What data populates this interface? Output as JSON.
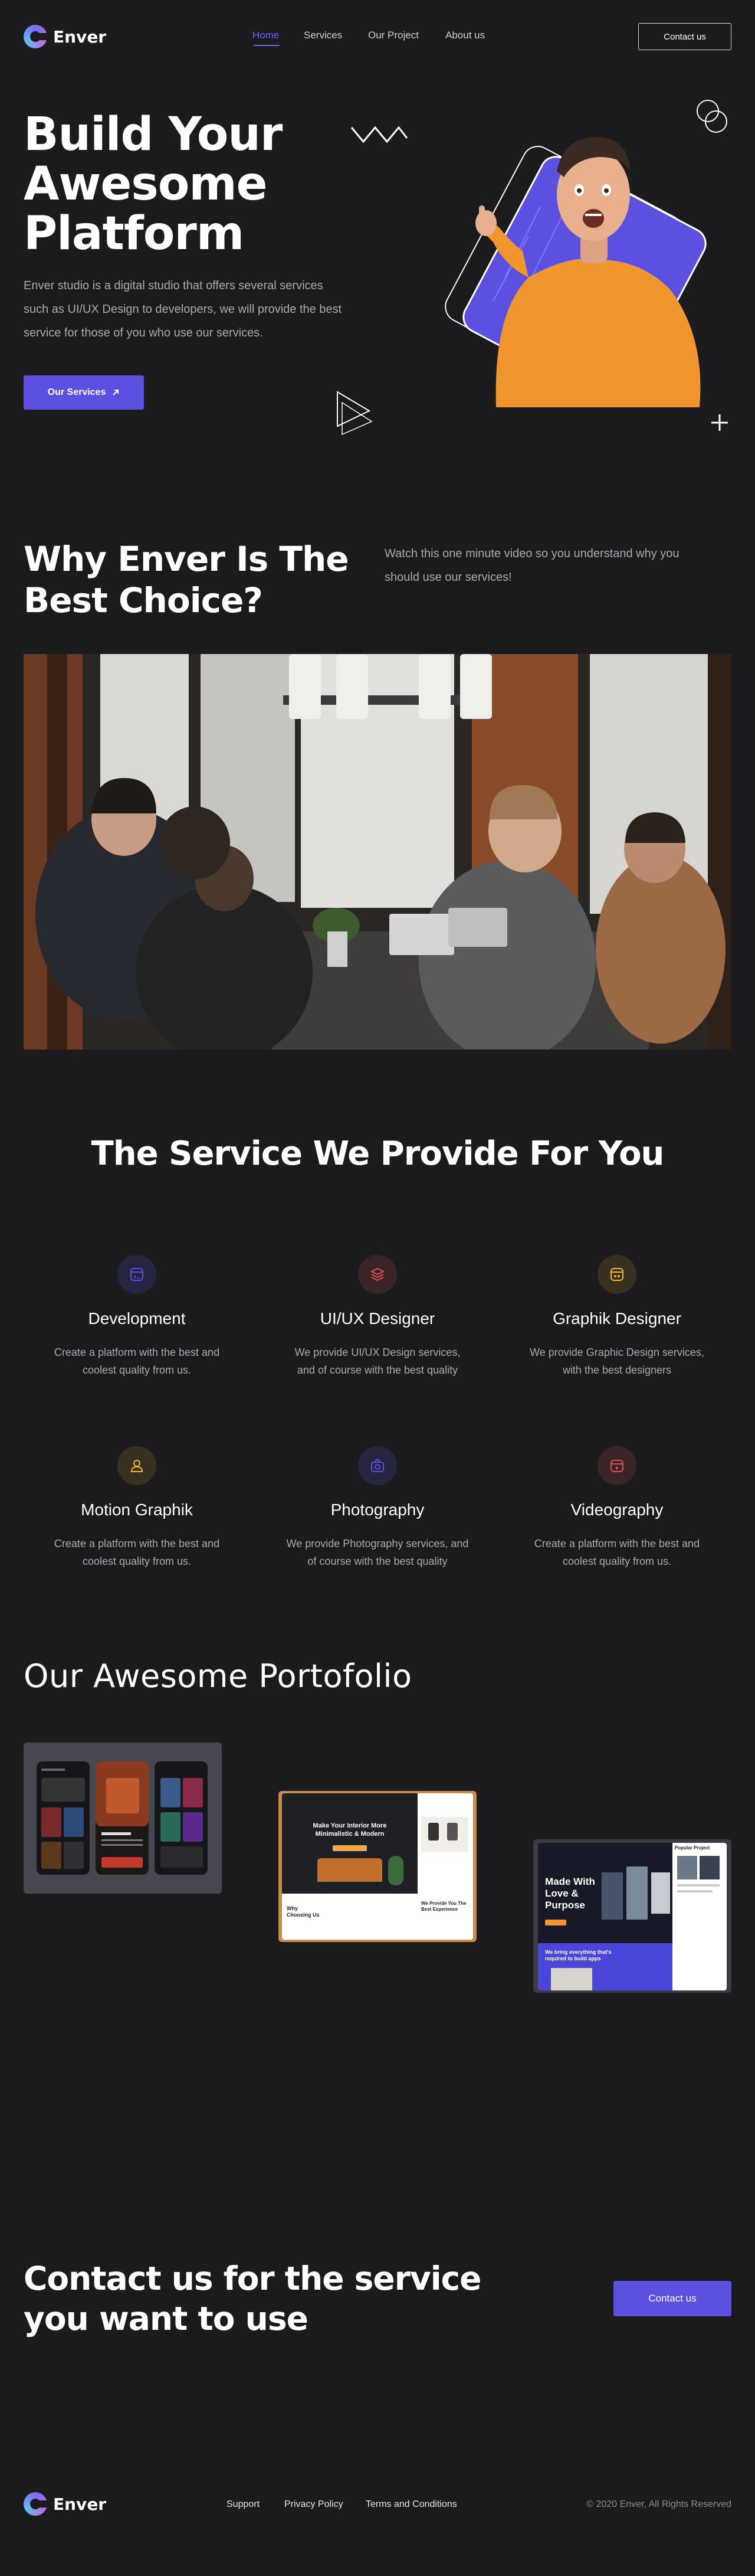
{
  "brand": {
    "name": "Enver"
  },
  "nav": {
    "items": [
      {
        "label": "Home",
        "active": true
      },
      {
        "label": "Services",
        "active": false
      },
      {
        "label": "Our Project",
        "active": false
      },
      {
        "label": "About us",
        "active": false
      }
    ],
    "cta": "Contact us",
    "accent_color": "#6c63ff"
  },
  "hero": {
    "title_lines": [
      "Build Your",
      "Awesome",
      "Platform"
    ],
    "description_lines": [
      "Enver studio is a digital studio that offers several services",
      "such as UI/UX Design to developers, we will provide the best",
      "service for those of you who use our services."
    ],
    "button": "Our Services"
  },
  "why": {
    "title_lines": [
      "Why Enver Is The",
      "Best Choice?"
    ],
    "text_lines": [
      "Watch this one minute video so you understand why you",
      "should use our services!"
    ]
  },
  "services": {
    "title": "The Service We Provide For You",
    "items": [
      {
        "title": "Development",
        "lines": [
          "Create a platform with the best and",
          "coolest quality from us."
        ],
        "icon": "monitor-icon",
        "color": "#5b50e0"
      },
      {
        "title": "UI/UX Designer",
        "lines": [
          "We provide UI/UX Design services,",
          "and of course with the best quality"
        ],
        "icon": "layers-icon",
        "color": "#e05050"
      },
      {
        "title": "Graphik Designer",
        "lines": [
          "We provide Graphic Design services,",
          "with the best designers"
        ],
        "icon": "palette-icon",
        "color": "#f2b733"
      },
      {
        "title": "Motion Graphik",
        "lines": [
          "Create a platform with the best and",
          "coolest quality from us."
        ],
        "icon": "user-icon",
        "color": "#f2b733"
      },
      {
        "title": "Photography",
        "lines": [
          "We provide Photography services, and",
          "of course with the best quality"
        ],
        "icon": "camera-icon",
        "color": "#5b50e0"
      },
      {
        "title": "Videography",
        "lines": [
          "Create a platform with the best and",
          "coolest quality from us."
        ],
        "icon": "video-icon",
        "color": "#e05050"
      }
    ]
  },
  "portfolio": {
    "title": "Our Awesome Portofolio",
    "items": [
      {
        "name": "movie-app"
      },
      {
        "name": "interior-site",
        "heading_lines": [
          "Make Your Interior More",
          "Minimalistic & Modern"
        ],
        "caption_lines": [
          "Why",
          "Choosing Us"
        ],
        "right_caption_lines": [
          "We Provide You The",
          "Best Experience"
        ]
      },
      {
        "name": "agency-site",
        "heading_lines": [
          "Made With",
          "Love &",
          "Purpose"
        ],
        "side_label": "Popular Project",
        "footer_lines": [
          "We bring everything that's",
          "required to build apps"
        ]
      }
    ]
  },
  "contact": {
    "title_lines": [
      "Contact us for the service",
      "you want to use"
    ],
    "button": "Contact us"
  },
  "footer": {
    "links": [
      "Support",
      "Privacy Policy",
      "Terms and Conditions"
    ],
    "copyright": "© 2020 Enver, All Rights Reserved"
  }
}
